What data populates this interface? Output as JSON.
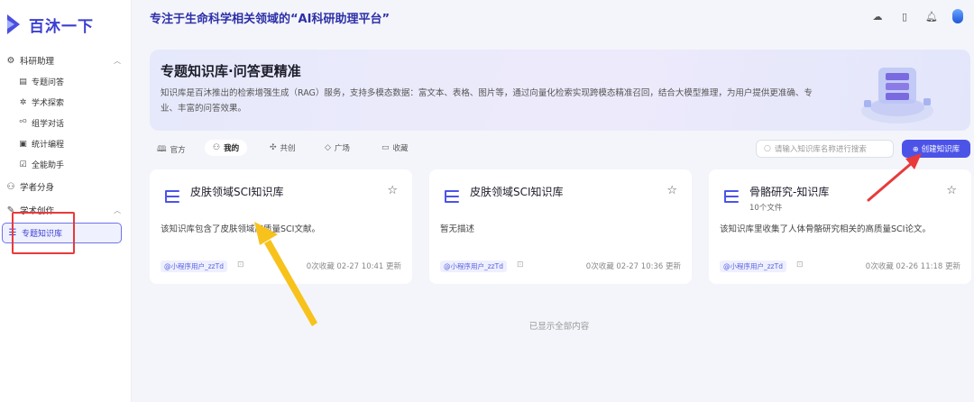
{
  "app": {
    "logo_text": "百沐一下"
  },
  "header": {
    "title": "专注于生命科学相关领域的“AI科研助理平台”"
  },
  "sidebar": {
    "group_research": "科研助理",
    "sub_items": [
      "专题问答",
      "学术探索",
      "组学对话",
      "统计编程",
      "全能助手"
    ],
    "scholar": "学者分身",
    "academic_writing": "学术创作",
    "active_item": "专题知识库"
  },
  "banner": {
    "title": "专题知识库·问答更精准",
    "description": "知识库是百沐推出的检索增强生成（RAG）服务，支持多模态数据：富文本、表格、图片等，通过向量化检索实现跨模态精准召回，结合大模型推理，为用户提供更准确、专业、丰富的问答效果。"
  },
  "tabs": [
    "官方",
    "我的",
    "共创",
    "广场",
    "收藏"
  ],
  "active_tab": "我的",
  "search": {
    "placeholder": "请输入知识库名称进行搜索"
  },
  "create_button": "创建知识库",
  "cards": [
    {
      "title": "皮肤领域SCI知识库",
      "subtitle": "",
      "description": "该知识库包含了皮肤领域高质量SCI文献。",
      "tag": "@小程序用户_zzTd",
      "meta": "0次收藏   02-27 10:41 更新"
    },
    {
      "title": "皮肤领域SCI知识库",
      "subtitle": "",
      "description": "暂无描述",
      "tag": "@小程序用户_zzTd",
      "meta": "0次收藏   02-27 10:36 更新"
    },
    {
      "title": "骨骼研究-知识库",
      "subtitle": "10个文件",
      "description": "该知识库里收集了人体骨骼研究相关的高质量SCI论文。",
      "tag": "@小程序用户_zzTd",
      "meta": "0次收藏   02-26 11:18 更新"
    }
  ],
  "end_note": "已显示全部内容",
  "colors": {
    "brand": "#3b3fd1",
    "accent": "#4c54e8",
    "highlight_red": "#e83a3a",
    "arrow_yellow": "#f7c21b"
  }
}
